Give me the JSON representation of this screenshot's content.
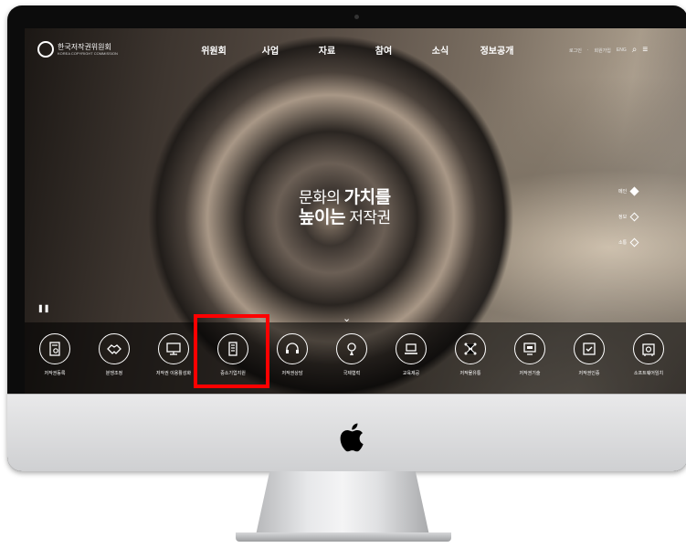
{
  "site": {
    "logo_text": "한국저작권위원회",
    "logo_sub": "KOREA COPYRIGHT COMMISSION"
  },
  "menu": [
    "위원회",
    "사업",
    "자료",
    "참여",
    "소식",
    "정보공개"
  ],
  "util": {
    "login": "로그인",
    "sep": "·",
    "join": "회원가입",
    "lang": "ENG"
  },
  "hero": {
    "line1_pre": "문화의",
    "line1_strong": "가치를",
    "line2_strong": "높이는",
    "line2_post": "저작권"
  },
  "side_nav": [
    {
      "label": "메인",
      "active": true
    },
    {
      "label": "정보",
      "active": false
    },
    {
      "label": "소통",
      "active": false
    }
  ],
  "quick_links": [
    {
      "label": "저작권등록",
      "icon": "document-stamp-icon"
    },
    {
      "label": "분쟁조정",
      "icon": "handshake-icon"
    },
    {
      "label": "저작권 이용활성화",
      "icon": "monitor-icon"
    },
    {
      "label": "중소기업지원",
      "icon": "building-icon",
      "highlighted": true
    },
    {
      "label": "저작권상담",
      "icon": "headset-icon"
    },
    {
      "label": "국제협력",
      "icon": "globe-pin-icon"
    },
    {
      "label": "교육제공",
      "icon": "laptop-icon"
    },
    {
      "label": "저작물유통",
      "icon": "network-icon"
    },
    {
      "label": "저작권기술",
      "icon": "computer-icon"
    },
    {
      "label": "저작권인증",
      "icon": "certificate-icon"
    },
    {
      "label": "소프트웨어임치",
      "icon": "safe-icon"
    }
  ],
  "colors": {
    "highlight": "#ff0000",
    "screen_bg": "#3d352f"
  }
}
